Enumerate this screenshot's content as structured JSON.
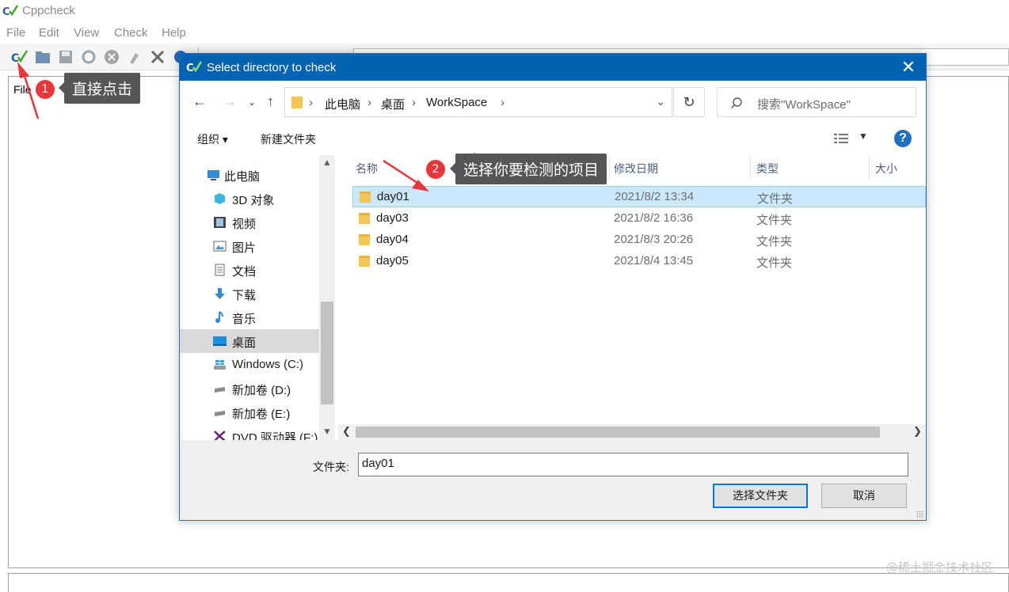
{
  "app": {
    "title": "Cppcheck",
    "menu": [
      "File",
      "Edit",
      "View",
      "Check",
      "Help"
    ],
    "main_label": "File"
  },
  "annotations": {
    "step1_badge": "1",
    "step1_text": "直接点击",
    "step2_badge": "2",
    "step2_text": "选择你要检测的项目"
  },
  "dialog": {
    "title": "Select directory to check",
    "close_glyph": "✕",
    "breadcrumbs": [
      "此电脑",
      "桌面",
      "WorkSpace"
    ],
    "search_placeholder": "搜索\"WorkSpace\"",
    "commands": {
      "organize": "组织 ▾",
      "new_folder": "新建文件夹",
      "help": "?"
    },
    "tree": [
      {
        "label": "此电脑",
        "icon": "computer-icon"
      },
      {
        "label": "3D 对象",
        "icon": "3d-objects-icon"
      },
      {
        "label": "视频",
        "icon": "video-icon"
      },
      {
        "label": "图片",
        "icon": "pictures-icon"
      },
      {
        "label": "文档",
        "icon": "documents-icon"
      },
      {
        "label": "下载",
        "icon": "download-icon"
      },
      {
        "label": "音乐",
        "icon": "music-icon"
      },
      {
        "label": "桌面",
        "icon": "desktop-icon",
        "selected": true
      },
      {
        "label": "Windows (C:)",
        "icon": "drive-icon"
      },
      {
        "label": "新加卷 (D:)",
        "icon": "drive-icon"
      },
      {
        "label": "新加卷 (E:)",
        "icon": "drive-icon"
      },
      {
        "label": "DVD 驱动器 (F:)",
        "icon": "dvd-icon"
      }
    ],
    "columns": [
      "名称",
      "修改日期",
      "类型",
      "大小"
    ],
    "rows": [
      {
        "name": "day01",
        "date": "2021/8/2 13:34",
        "type": "文件夹",
        "selected": true
      },
      {
        "name": "day03",
        "date": "2021/8/2 16:36",
        "type": "文件夹"
      },
      {
        "name": "day04",
        "date": "2021/8/3 20:26",
        "type": "文件夹"
      },
      {
        "name": "day05",
        "date": "2021/8/4 13:45",
        "type": "文件夹"
      }
    ],
    "folder_label": "文件夹:",
    "folder_value": "day01",
    "select_button": "选择文件夹",
    "cancel_button": "取消"
  },
  "watermark": "@稀土掘金技术社区",
  "colors": {
    "title_blue": "#0063b1",
    "selection": "#cce8ff",
    "annotation_red": "#e8363a",
    "callout_bg": "#565656"
  }
}
